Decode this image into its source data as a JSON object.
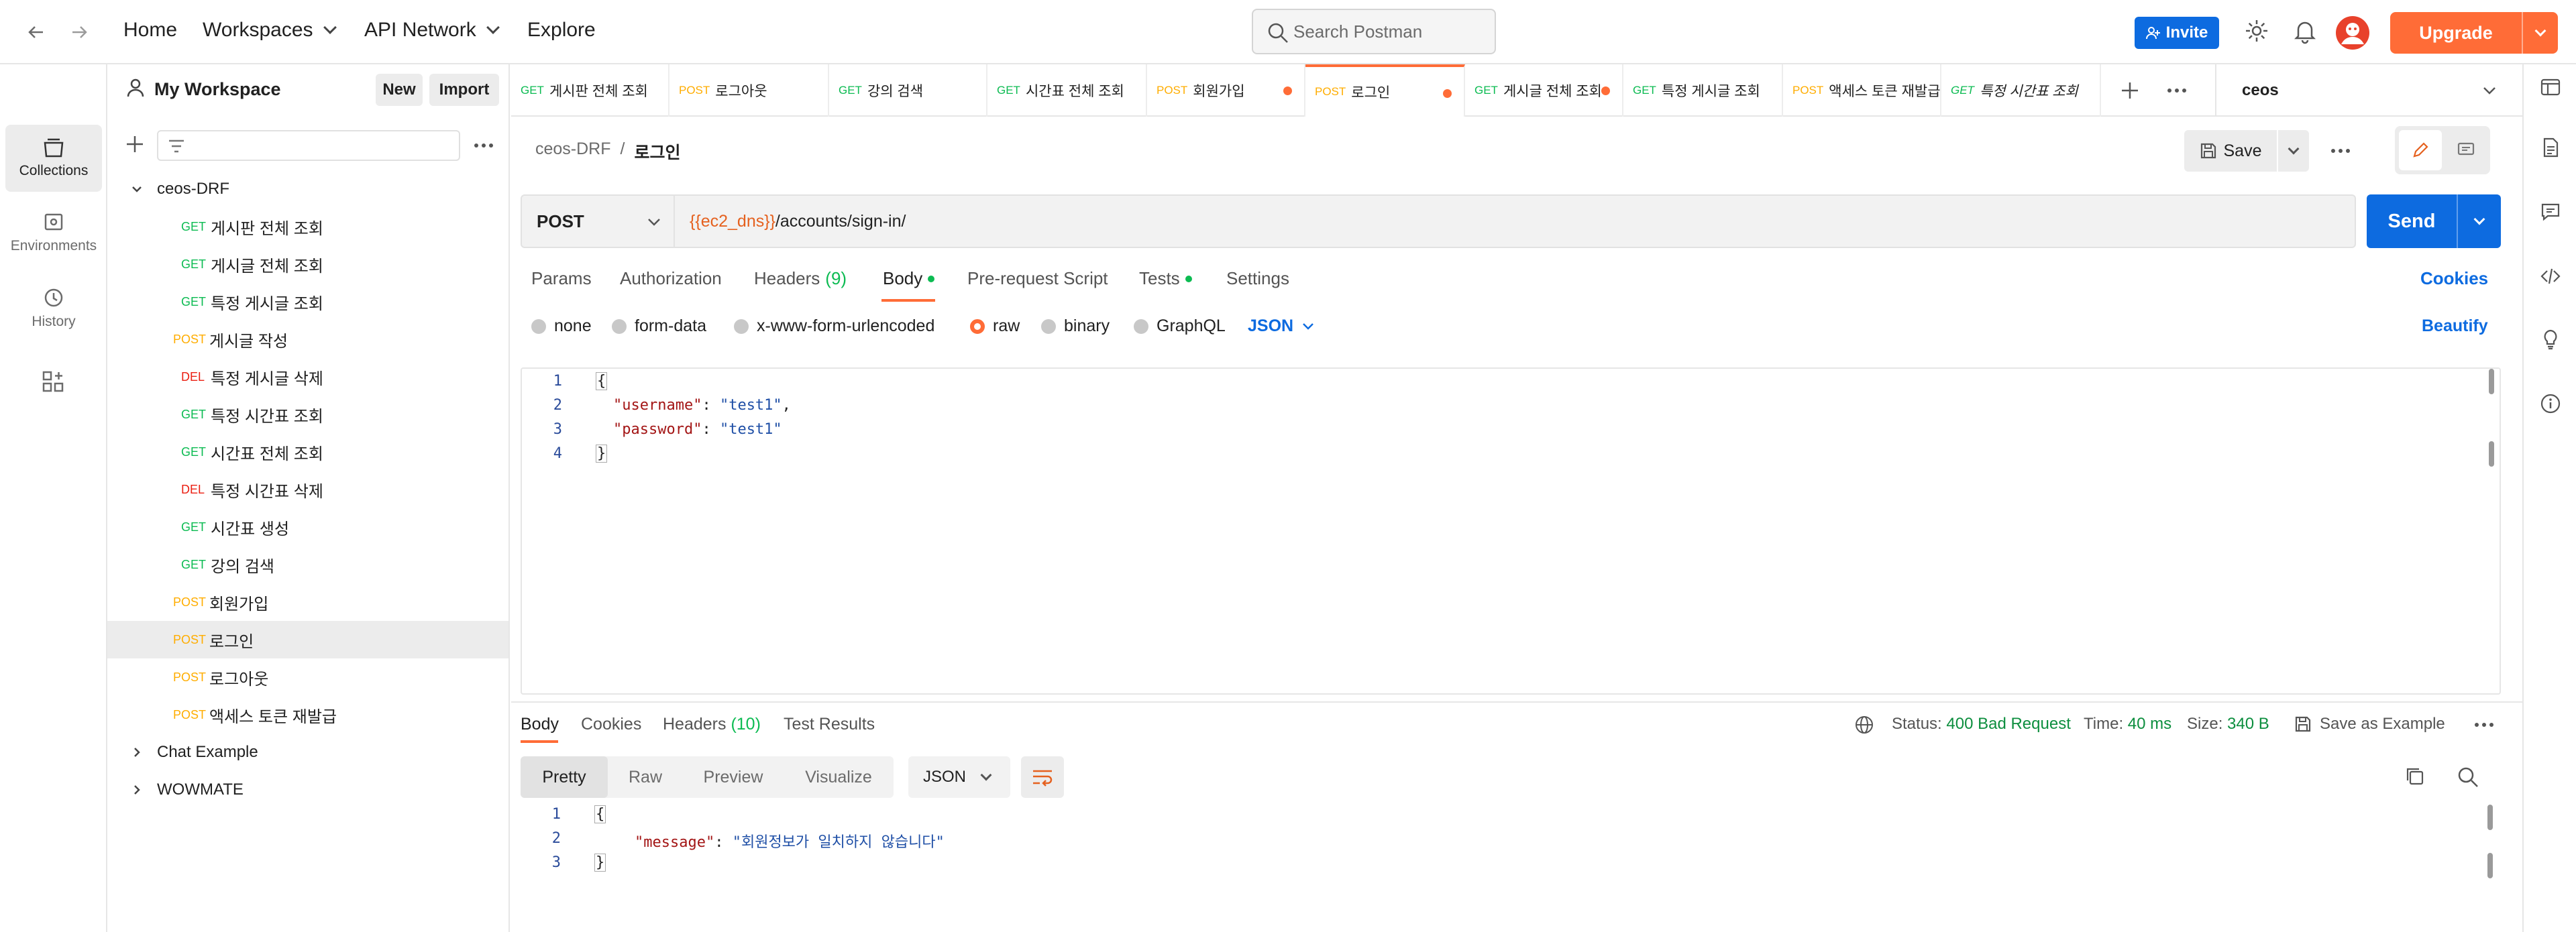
{
  "topbar": {
    "home": "Home",
    "workspaces": "Workspaces",
    "api_network": "API Network",
    "explore": "Explore",
    "search_placeholder": "Search Postman",
    "invite": "Invite",
    "upgrade": "Upgrade"
  },
  "rail": {
    "collections": "Collections",
    "environments": "Environments",
    "history": "History"
  },
  "sidebar": {
    "workspace": "My Workspace",
    "new": "New",
    "import": "Import",
    "collection": "ceos-DRF",
    "items": [
      {
        "method": "GET",
        "name": "게시판 전체 조회"
      },
      {
        "method": "GET",
        "name": "게시글 전체 조회"
      },
      {
        "method": "GET",
        "name": "특정 게시글 조회"
      },
      {
        "method": "POST",
        "name": "게시글 작성"
      },
      {
        "method": "DEL",
        "name": "특정 게시글 삭제"
      },
      {
        "method": "GET",
        "name": "특정 시간표 조회"
      },
      {
        "method": "GET",
        "name": "시간표 전체 조회"
      },
      {
        "method": "DEL",
        "name": "특정 시간표 삭제"
      },
      {
        "method": "GET",
        "name": "시간표 생성"
      },
      {
        "method": "GET",
        "name": "강의 검색"
      },
      {
        "method": "POST",
        "name": "회원가입"
      },
      {
        "method": "POST",
        "name": "로그인"
      },
      {
        "method": "POST",
        "name": "로그아웃"
      },
      {
        "method": "POST",
        "name": "액세스 토큰 재발급"
      }
    ],
    "other_collections": [
      "Chat Example",
      "WOWMATE"
    ]
  },
  "tabs": [
    {
      "method": "GET",
      "name": "게시판 전체 조회"
    },
    {
      "method": "POST",
      "name": "로그아웃"
    },
    {
      "method": "GET",
      "name": "강의 검색"
    },
    {
      "method": "GET",
      "name": "시간표 전체 조회"
    },
    {
      "method": "POST",
      "name": "회원가입"
    },
    {
      "method": "POST",
      "name": "로그인"
    },
    {
      "method": "GET",
      "name": "게시글 전체 조회"
    },
    {
      "method": "GET",
      "name": "특정 게시글 조회"
    },
    {
      "method": "POST",
      "name": "액세스 토큰 재발급"
    },
    {
      "method": "GET",
      "name": "특정 시간표 조회"
    }
  ],
  "environment": "ceos",
  "request": {
    "collection": "ceos-DRF",
    "sep": "/",
    "name": "로그인",
    "save": "Save",
    "method": "POST",
    "url_var": "{{ec2_dns}}",
    "url_path": "/accounts/sign-in/",
    "send": "Send",
    "tabs": {
      "params": "Params",
      "authorization": "Authorization",
      "headers": "Headers",
      "headers_count": "(9)",
      "body": "Body",
      "prerequest": "Pre-request Script",
      "tests": "Tests",
      "settings": "Settings",
      "cookies": "Cookies"
    },
    "body_types": {
      "none": "none",
      "form_data": "form-data",
      "urlencoded": "x-www-form-urlencoded",
      "raw": "raw",
      "binary": "binary",
      "graphql": "GraphQL",
      "format": "JSON",
      "beautify": "Beautify"
    },
    "code": {
      "l1": "1",
      "l2": "2",
      "l3": "3",
      "l4": "4",
      "open": "{",
      "k1": "\"username\"",
      "v1": "\"test1\"",
      "k2": "\"password\"",
      "v2": "\"test1\"",
      "close": "}"
    }
  },
  "response": {
    "tabs": {
      "body": "Body",
      "cookies": "Cookies",
      "headers": "Headers",
      "headers_count": "(10)",
      "test_results": "Test Results"
    },
    "status_label": "Status:",
    "status": "400 Bad Request",
    "time_label": "Time:",
    "time": "40 ms",
    "size_label": "Size:",
    "size": "340 B",
    "save_example": "Save as Example",
    "views": {
      "pretty": "Pretty",
      "raw": "Raw",
      "preview": "Preview",
      "visualize": "Visualize"
    },
    "format": "JSON",
    "code": {
      "l1": "1",
      "l2": "2",
      "l3": "3",
      "open": "{",
      "key": "\"message\"",
      "value": "\"회원정보가 일치하지 않습니다\"",
      "close": "}"
    }
  },
  "colors": {
    "accent": "#ff6c37",
    "primary": "#0d6be0",
    "get": "#0cbb52",
    "post": "#ffad00",
    "delete": "#eb2013"
  }
}
